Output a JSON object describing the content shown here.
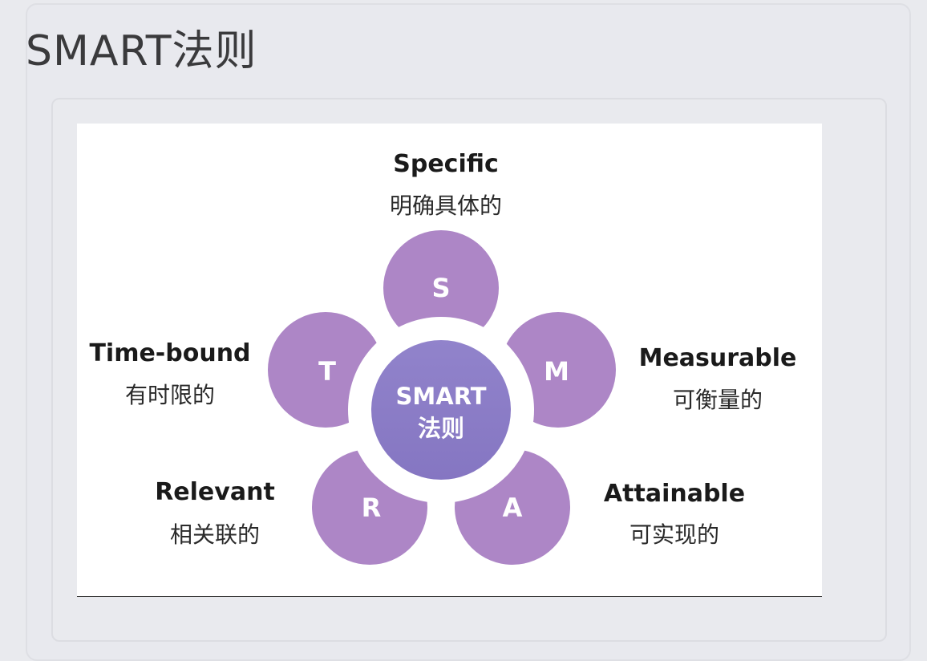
{
  "card": {
    "title": "SMART法则"
  },
  "diagram": {
    "center": {
      "line1": "SMART",
      "line2": "法则"
    },
    "colors": {
      "petal": "#ad86c6",
      "petal_stroke": "#ffffff",
      "center_top": "#8f7fc9",
      "center_bottom": "#8a7bc4",
      "ring": "#ffffff"
    },
    "items": [
      {
        "letter": "S",
        "en": "Specific",
        "cn": "明确具体的"
      },
      {
        "letter": "M",
        "en": "Measurable",
        "cn": "可衡量的"
      },
      {
        "letter": "A",
        "en": "Attainable",
        "cn": "可实现的"
      },
      {
        "letter": "R",
        "en": "Relevant",
        "cn": "相关联的"
      },
      {
        "letter": "T",
        "en": "Time-bound",
        "cn": "有时限的"
      }
    ]
  }
}
